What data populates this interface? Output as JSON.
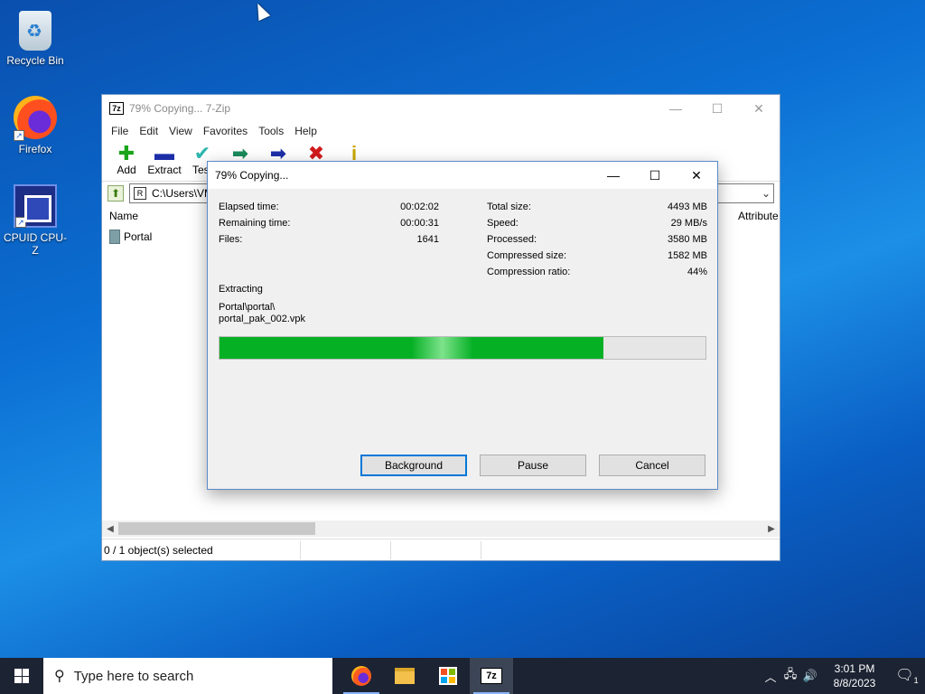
{
  "desktop": {
    "icons": [
      {
        "label": "Recycle Bin"
      },
      {
        "label": "Firefox"
      },
      {
        "label": "CPUID CPU-Z"
      }
    ]
  },
  "main_window": {
    "title": "79% Copying... 7-Zip",
    "app_icon_text": "7z",
    "menu": [
      "File",
      "Edit",
      "View",
      "Favorites",
      "Tools",
      "Help"
    ],
    "toolbar": [
      {
        "label": "Add",
        "icon": "plus-icon",
        "color": "#1aa51a"
      },
      {
        "label": "Extract",
        "icon": "minus-icon",
        "color": "#1c2fa8"
      },
      {
        "label": "Test",
        "icon": "check-icon",
        "color": "#2fb7b0"
      },
      {
        "label": "Copy",
        "icon": "copy-arrow-icon",
        "color": "#1a8a5a"
      },
      {
        "label": "Move",
        "icon": "move-arrow-icon",
        "color": "#1c2fa8"
      },
      {
        "label": "Delete",
        "icon": "delete-x-icon",
        "color": "#d11a1a"
      },
      {
        "label": "Info",
        "icon": "info-icon",
        "color": "#c8a800"
      }
    ],
    "address": "C:\\Users\\VM",
    "columns": {
      "name": "Name",
      "attributes": "Attribute"
    },
    "rows": [
      {
        "name": "Portal"
      }
    ],
    "status": "0 / 1 object(s) selected"
  },
  "dialog": {
    "title": "79% Copying...",
    "left_stats": [
      {
        "label": "Elapsed time:",
        "value": "00:02:02"
      },
      {
        "label": "Remaining time:",
        "value": "00:00:31"
      },
      {
        "label": "Files:",
        "value": "1641"
      }
    ],
    "right_stats": [
      {
        "label": "Total size:",
        "value": "4493 MB"
      },
      {
        "label": "Speed:",
        "value": "29 MB/s"
      },
      {
        "label": "Processed:",
        "value": "3580 MB"
      },
      {
        "label": "Compressed size:",
        "value": "1582 MB"
      },
      {
        "label": "Compression ratio:",
        "value": "44%"
      }
    ],
    "operation": "Extracting",
    "path_line1": "Portal\\portal\\",
    "path_line2": "portal_pak_002.vpk",
    "progress_fraction": 0.79,
    "buttons": {
      "background": "Background",
      "pause": "Pause",
      "cancel": "Cancel"
    }
  },
  "taskbar": {
    "search_placeholder": "Type here to search",
    "time": "3:01 PM",
    "date": "8/8/2023",
    "notification_count": "1",
    "sevenzip_label": "7z"
  }
}
